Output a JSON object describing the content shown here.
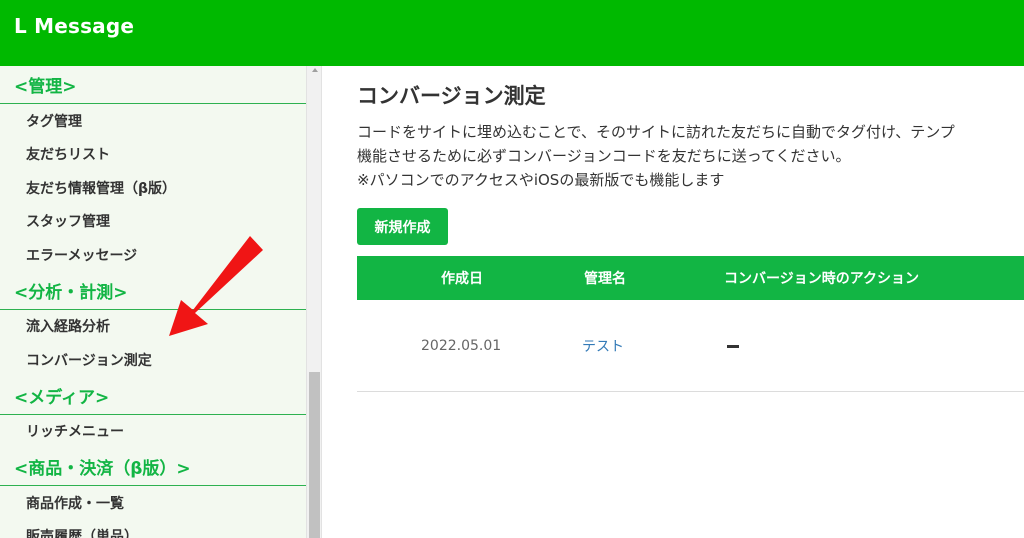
{
  "app": {
    "brand": "L Message"
  },
  "sidebar": {
    "groups": [
      {
        "title": "<管理>",
        "items": [
          "タグ管理",
          "友だちリスト",
          "友だち情報管理（β版）",
          "スタッフ管理",
          "エラーメッセージ"
        ]
      },
      {
        "title": "<分析・計測>",
        "items": [
          "流入経路分析",
          "コンバージョン測定"
        ]
      },
      {
        "title": "<メディア>",
        "items": [
          "リッチメニュー"
        ]
      },
      {
        "title": "<商品・決済（β版）>",
        "items": [
          "商品作成・一覧",
          "販売履歴（単品）"
        ]
      }
    ],
    "active_item": "コンバージョン測定"
  },
  "main": {
    "title": "コンバージョン測定",
    "description": [
      "コードをサイトに埋め込むことで、そのサイトに訪れた友だちに自動でタグ付け、テンプ",
      "機能させるために必ずコンバージョンコードを友だちに送ってください。",
      "※パソコンでのアクセスやiOSの最新版でも機能します"
    ],
    "new_button": "新規作成",
    "table": {
      "headers": [
        "作成日",
        "管理名",
        "コンバージョン時のアクション"
      ],
      "rows": [
        {
          "date": "2022.05.01",
          "name": "テスト",
          "action": "dash"
        }
      ]
    }
  },
  "colors": {
    "topbar": "#00b900",
    "accent": "#12b544",
    "sidebar_bg": "#f3f9f0",
    "link": "#337ab7",
    "annotation_arrow": "#f01515"
  },
  "icons": {
    "annotation": "red-arrow-icon"
  }
}
